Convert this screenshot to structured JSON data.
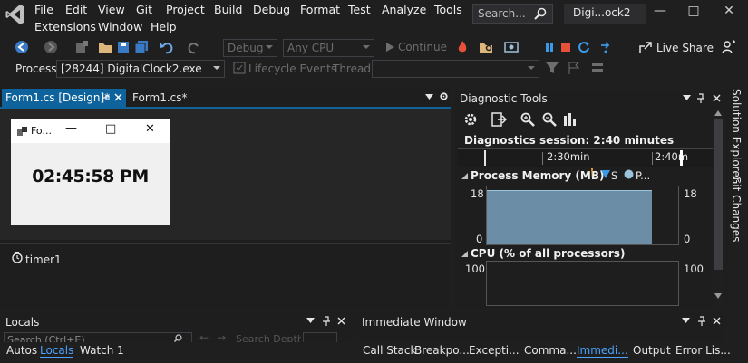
{
  "menu": {
    "items": [
      "File",
      "Edit",
      "View",
      "Git",
      "Project",
      "Build",
      "Debug",
      "Format",
      "Test",
      "Analyze",
      "Tools"
    ],
    "items_row2": [
      "Extensions",
      "Window",
      "Help"
    ],
    "search_placeholder": "Search...",
    "title": "Digi...ock2"
  },
  "toolbar": {
    "config_combo": "Debug",
    "platform_combo": "Any CPU",
    "continue_label": "Continue",
    "live_share_label": "Live Share"
  },
  "debug_bar": {
    "process_label": "Process:",
    "process_value": "[28244] DigitalClock2.exe",
    "lifecycle_label": "Lifecycle Events",
    "thread_label": "Thread:"
  },
  "documents": {
    "tabs": [
      {
        "label": "Form1.cs [Design]*",
        "active": true
      },
      {
        "label": "Form1.cs*",
        "active": false
      }
    ],
    "form": {
      "title": "Fo...",
      "clock_text": "02:45:58 PM"
    },
    "tray_component": "timer1"
  },
  "diagnostics": {
    "title": "Diagnostic Tools",
    "session": "Diagnostics session: 2:40 minutes",
    "timeline_ticks": [
      "2:30min",
      "2:40m"
    ],
    "memory": {
      "label": "Process Memory (MB)",
      "legend": [
        "S",
        "P..."
      ],
      "max_left": "18",
      "min_left": "0",
      "max_right": "18",
      "min_right": "0",
      "fill_fraction": 1.0
    },
    "cpu": {
      "label": "CPU (% of all processors)",
      "max_left": "100",
      "max_right": "100"
    }
  },
  "side_tabs": [
    "Solution Explorer",
    "Git Changes"
  ],
  "locals_panel": {
    "title": "Locals",
    "search_placeholder": "Search (Ctrl+E)",
    "search_depth": "Search Depth:"
  },
  "immediate_panel": {
    "title": "Immediate Window"
  },
  "bottom_tabs_left": [
    {
      "label": "Autos",
      "active": false
    },
    {
      "label": "Locals",
      "active": true
    },
    {
      "label": "Watch 1",
      "active": false
    }
  ],
  "bottom_tabs_right": [
    {
      "label": "Call Stack",
      "active": false
    },
    {
      "label": "Breakpo...",
      "active": false
    },
    {
      "label": "Excepti...",
      "active": false
    },
    {
      "label": "Comma...",
      "active": false
    },
    {
      "label": "Immedi...",
      "active": true
    },
    {
      "label": "Output",
      "active": false
    },
    {
      "label": "Error Lis...",
      "active": false
    }
  ],
  "colors": {
    "accent": "#0e639c",
    "graph_fill": "#6b8ea6",
    "active_tab_text": "#4aa3ff"
  }
}
